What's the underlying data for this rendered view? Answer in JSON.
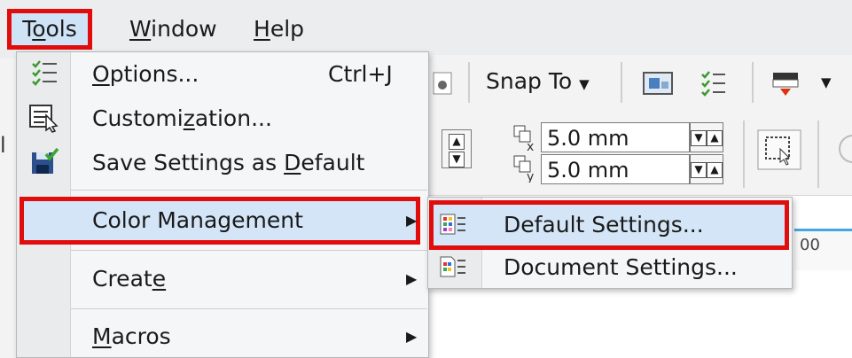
{
  "menubar": {
    "tools": {
      "pre": "T",
      "accel": "o",
      "post": "ols"
    },
    "window": {
      "pre": "",
      "accel": "W",
      "post": "indow"
    },
    "help": {
      "pre": "",
      "accel": "H",
      "post": "elp"
    }
  },
  "toolbar": {
    "snap_to_label": "Snap To",
    "dup_x_value": "5.0 mm",
    "dup_y_value": "5.0 mm",
    "ruler_fragment": "00"
  },
  "tools_menu": {
    "options": {
      "pre": "",
      "accel": "O",
      "post": "ptions...",
      "shortcut": "Ctrl+J"
    },
    "customization": {
      "pre": "Customi",
      "accel": "z",
      "post": "ation..."
    },
    "save_settings": {
      "pre": "Save Settings as ",
      "accel": "D",
      "post": "efault"
    },
    "color_management": {
      "label": "Color Management"
    },
    "create": {
      "pre": "Creat",
      "accel": "e",
      "post": ""
    },
    "macros": {
      "pre": "",
      "accel": "M",
      "post": "acros"
    }
  },
  "color_submenu": {
    "default_settings": "Default Settings...",
    "document_settings": "Document Settings..."
  },
  "colors": {
    "highlight_border": "#e10c0c",
    "highlight_fill": "#d3e5f6"
  }
}
